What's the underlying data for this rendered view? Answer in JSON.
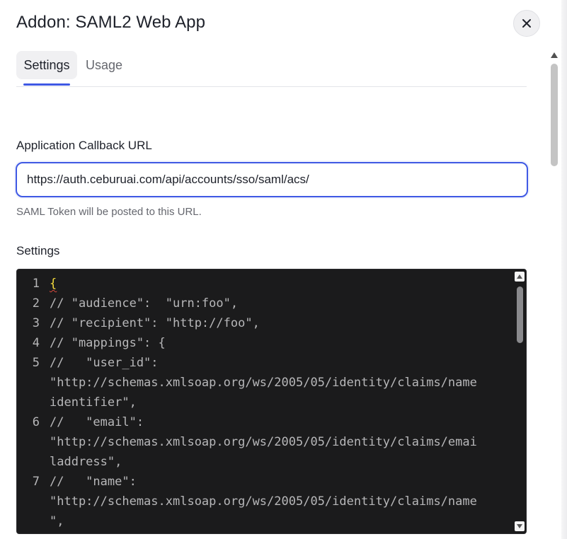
{
  "dialog": {
    "title": "Addon: SAML2 Web App",
    "close_label": "Close"
  },
  "tabs": [
    {
      "label": "Settings",
      "active": true
    },
    {
      "label": "Usage",
      "active": false
    }
  ],
  "callback": {
    "label": "Application Callback URL",
    "value": "https://auth.ceburuai.com/api/accounts/sso/saml/acs/",
    "hint": "SAML Token will be posted to this URL."
  },
  "settings": {
    "label": "Settings",
    "code": [
      {
        "num": "1",
        "text": "{"
      },
      {
        "num": "2",
        "text": "// \"audience\":  \"urn:foo\","
      },
      {
        "num": "3",
        "text": "// \"recipient\": \"http://foo\","
      },
      {
        "num": "4",
        "text": "// \"mappings\": {"
      },
      {
        "num": "5",
        "text": "//   \"user_id\":"
      },
      {
        "num": "",
        "text": "\"http://schemas.xmlsoap.org/ws/2005/05/identity/claims/name"
      },
      {
        "num": "",
        "text": "identifier\","
      },
      {
        "num": "6",
        "text": "//   \"email\":"
      },
      {
        "num": "",
        "text": "\"http://schemas.xmlsoap.org/ws/2005/05/identity/claims/emai"
      },
      {
        "num": "",
        "text": "laddress\","
      },
      {
        "num": "7",
        "text": "//   \"name\":"
      },
      {
        "num": "",
        "text": "\"http://schemas.xmlsoap.org/ws/2005/05/identity/claims/name"
      },
      {
        "num": "",
        "text": "\","
      }
    ]
  },
  "colors": {
    "accent": "#3f59e4",
    "editor_bg": "#1b1b1c",
    "brace": "#f2d93c"
  }
}
